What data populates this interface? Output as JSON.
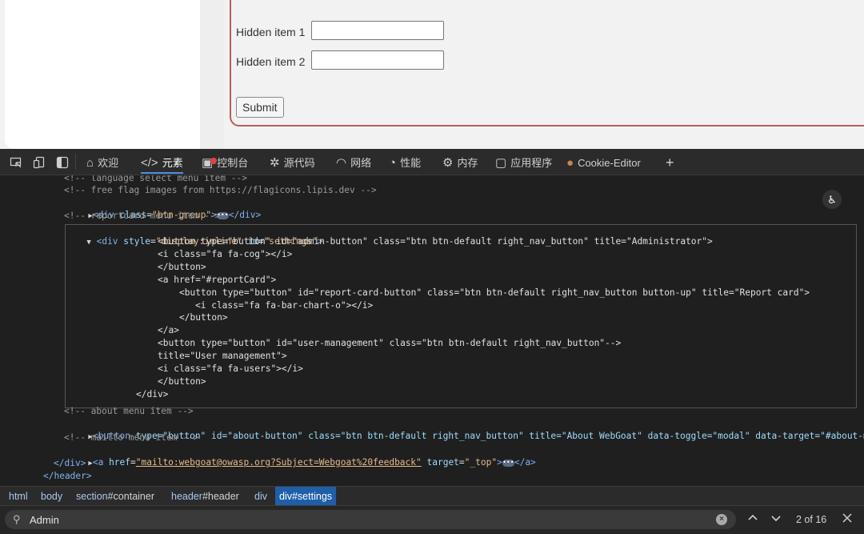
{
  "webpage": {
    "hidden_item_1_label": "Hidden item 1",
    "hidden_item_2_label": "Hidden item 2",
    "submit_label": "Submit"
  },
  "devtools": {
    "tabs": [
      {
        "label": "欢迎",
        "icon": "home-icon"
      },
      {
        "label": "元素",
        "icon": "code-brackets-icon",
        "active": true
      },
      {
        "label": "控制台",
        "icon": "console-icon"
      },
      {
        "label": "源代码",
        "icon": "bug-icon"
      },
      {
        "label": "网络",
        "icon": "wifi-icon"
      },
      {
        "label": "性能",
        "icon": "gauge-icon"
      },
      {
        "label": "内存",
        "icon": "chip-icon"
      },
      {
        "label": "应用程序",
        "icon": "window-icon"
      },
      {
        "label": "Cookie-Editor",
        "icon": "cookie-icon"
      }
    ],
    "code": {
      "l0": "<!-- language select menu item -->",
      "l1": "<!-- free flag images from https://flagicons.lipis.dev -->",
      "l2_tag": "<div ",
      "l2_attr": "class",
      "l2_val": "\"btn-group\"",
      "l2_end": "</div>",
      "l3": "<!-- reportcard menu item -->",
      "l4_tag": "<div ",
      "l4_a1": "style",
      "l4_v1": "\"display:inline\"",
      "l4_a2": "id",
      "l4_v2": "\"settings\"",
      "l5": "<button type=\"button\" id=\"admin-button\" class=\"btn btn-default right_nav_button\" title=\"Administrator\">",
      "l6": "<i class=\"fa fa-cog\"></i>",
      "l7": "</button>",
      "l8": "<a href=\"#reportCard\">",
      "l9": "<button type=\"button\" id=\"report-card-button\" class=\"btn btn-default right_nav_button button-up\" title=\"Report card\">",
      "l10": "<i class=\"fa fa-bar-chart-o\"></i>",
      "l11": "</button>",
      "l12": "</a>",
      "l13": "<button type=\"button\" id=\"user-management\" class=\"btn btn-default right_nav_button\"-->",
      "l14": "title=\"User management\">",
      "l15": "<i class=\"fa fa-users\"></i>",
      "l16": "</button>",
      "l17": "</div>",
      "l18": "<!-- about menu item -->",
      "l19_tag": "<button ",
      "l19_rest": "type=\"button\" id=\"about-button\" class=\"btn btn-default right_nav_button\" title=\"About WebGoat\" data-toggle=\"modal\" data-target=\"#about-mod",
      "l20": "<!-- mailto menu item -->",
      "l21_tag": "<a ",
      "l21_attr": "href",
      "l21_link": "\"mailto:webgoat@owasp.org?Subject=Webgoat%20feedback\"",
      "l21_a2": "target",
      "l21_v2": "\"_top\"",
      "l21_end": "</a>",
      "l22": "</div>",
      "l23": "</header>"
    },
    "breadcrumbs": [
      {
        "tag": "html",
        "id": ""
      },
      {
        "tag": "body",
        "id": ""
      },
      {
        "tag": "section",
        "id": "#container"
      },
      {
        "tag": "header",
        "id": "#header"
      },
      {
        "tag": "div",
        "id": ""
      },
      {
        "tag": "div",
        "id": "#settings",
        "selected": true
      }
    ],
    "search": {
      "value": "Admin",
      "match_count": "2 of 16"
    }
  }
}
